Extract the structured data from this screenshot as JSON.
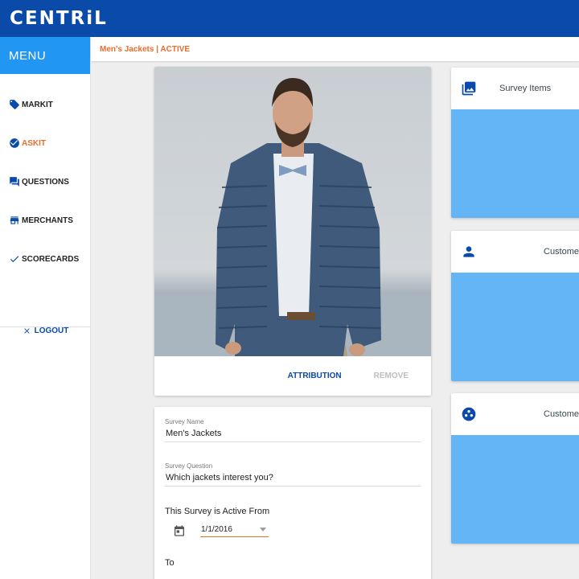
{
  "app": {
    "logo": "CENTRiL"
  },
  "sidebar": {
    "menu_label": "MENU",
    "items": [
      {
        "label": "MARKIT",
        "icon": "tag-icon"
      },
      {
        "label": "ASKIT",
        "icon": "check-circle-icon",
        "active": true
      },
      {
        "label": "QUESTIONS",
        "icon": "chat-icon"
      },
      {
        "label": "MERCHANTS",
        "icon": "store-icon"
      },
      {
        "label": "SCORECARDS",
        "icon": "checkmark-icon"
      }
    ],
    "logout_label": "LOGOUT"
  },
  "breadcrumb": {
    "text": "Men's Jackets | ACTIVE"
  },
  "image_card": {
    "attribution_label": "ATTRIBUTION",
    "remove_label": "REMOVE"
  },
  "form": {
    "survey_name_label": "Survey Name",
    "survey_name_value": "Men's Jackets",
    "survey_question_label": "Survey Question",
    "survey_question_value": "Which jackets interest you?",
    "active_from_label": "This Survey is Active From",
    "active_from_date": "1/1/2016",
    "to_label": "To"
  },
  "panels": [
    {
      "title": "Survey Items",
      "icon": "image-icon"
    },
    {
      "title": "Custome",
      "icon": "person-icon"
    },
    {
      "title": "Custome",
      "icon": "group-icon"
    }
  ],
  "colors": {
    "header": "#0a4aa8",
    "menu": "#2196f3",
    "accent": "#ef6c2a",
    "panel_body": "#64b5f6"
  }
}
